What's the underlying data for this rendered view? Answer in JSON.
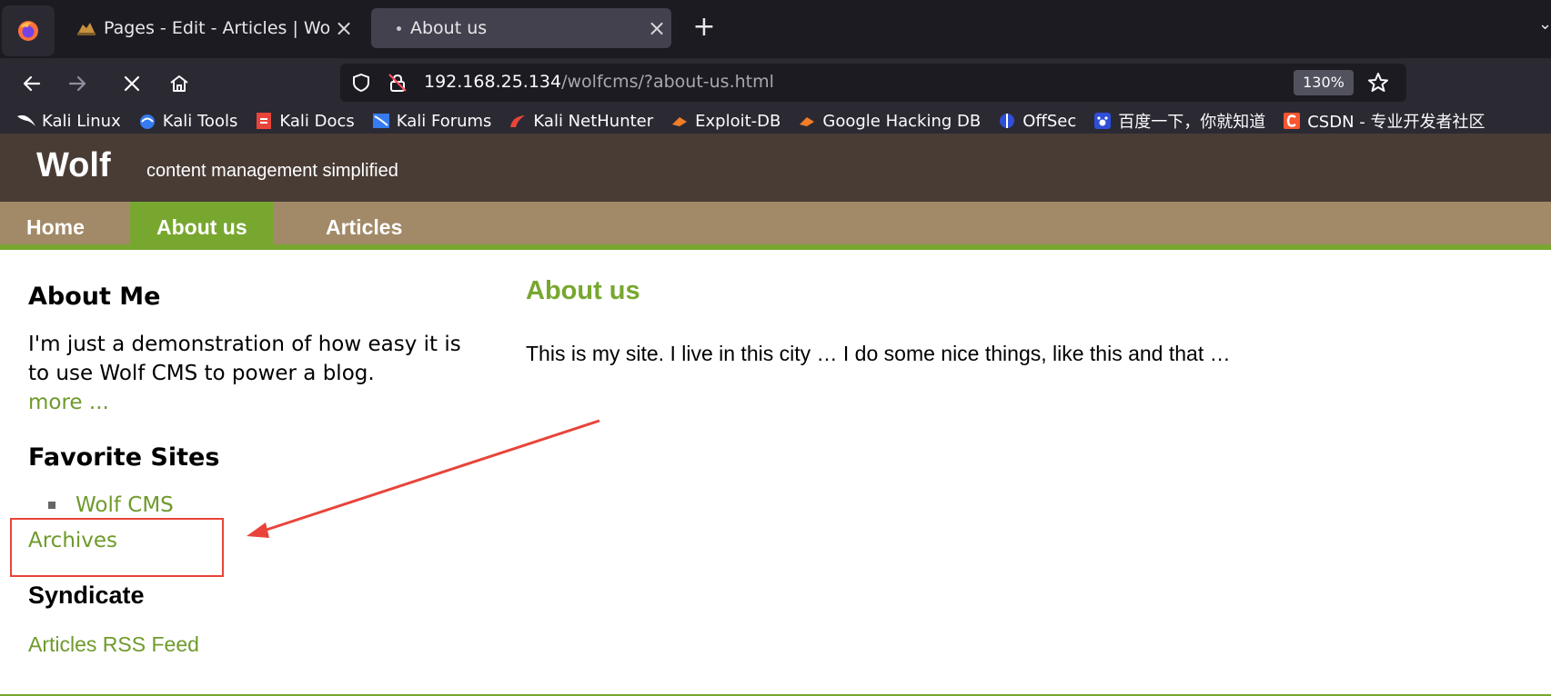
{
  "browser": {
    "tabs": [
      {
        "title": "Pages - Edit - Articles | Wolf CMS",
        "close": "×"
      },
      {
        "title": "About us",
        "close": "×"
      }
    ],
    "new_tab": "+",
    "tab_list": "⌄",
    "url": {
      "host": "192.168.25.134",
      "path": "/wolfcms/?about-us.html"
    },
    "zoom": "130%",
    "bookmarks": [
      "Kali Linux",
      "Kali Tools",
      "Kali Docs",
      "Kali Forums",
      "Kali NetHunter",
      "Exploit-DB",
      "Google Hacking DB",
      "OffSec",
      "百度一下，你就知道",
      "CSDN - 专业开发者社区"
    ]
  },
  "site": {
    "name": "Wolf",
    "slogan": "content management simplified",
    "nav": [
      "Home",
      "About us",
      "Articles"
    ]
  },
  "sidebar": {
    "about_title": "About Me",
    "about_text": "I'm just a demonstration of how easy it is to use Wolf CMS to power a blog.",
    "more_link": "more ...",
    "favorites_title": "Favorite Sites",
    "favorites": [
      "Wolf CMS"
    ],
    "archives_link": "Archives",
    "syndicate_title": "Syndicate",
    "rss_link": "Articles RSS Feed"
  },
  "content": {
    "title": "About us",
    "body": "This is my site. I live in this city … I do some nice things, like this and that …"
  },
  "colors": {
    "header_bg": "#493c35",
    "nav_bg": "#a28a69",
    "accent_green": "#78a730",
    "annotation_red": "#e8443a"
  }
}
